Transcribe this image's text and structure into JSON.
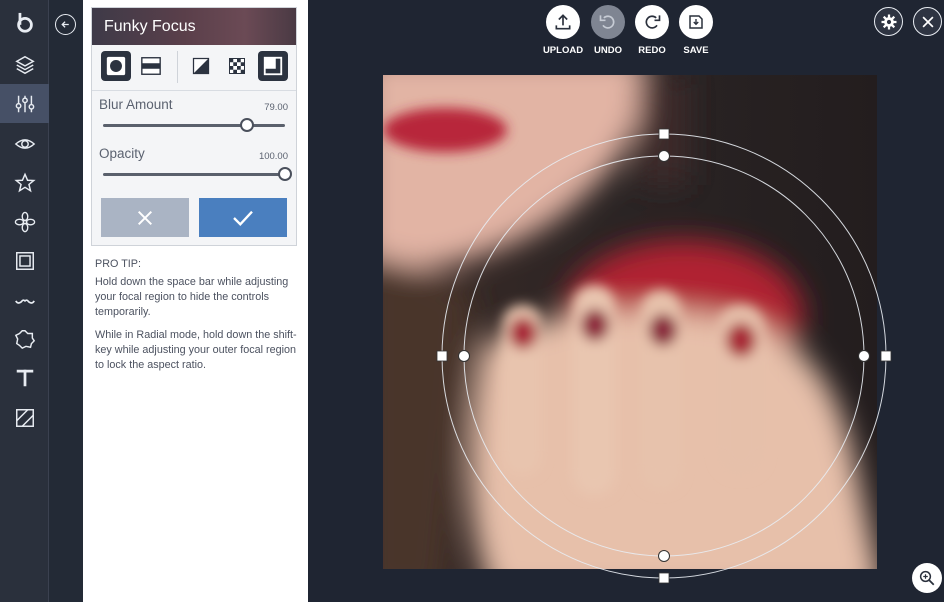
{
  "tool": {
    "title": "Funky Focus",
    "modes": [
      "radial-mode",
      "linear-mode",
      "invert-mode",
      "transparency-mode",
      "edge-mode"
    ],
    "blur": {
      "label": "Blur Amount",
      "value": "79.00",
      "fraction": 0.79
    },
    "opacity": {
      "label": "Opacity",
      "value": "100.00",
      "fraction": 1.0
    }
  },
  "tips": {
    "heading": "PRO TIP:",
    "p1": "Hold down the space bar while adjusting your focal region to hide the controls temporarily.",
    "p2": "While in Radial mode, hold down the shift-key while adjusting your outer focal region to lock the aspect ratio."
  },
  "toolbar": {
    "upload": "UPLOAD",
    "undo": "UNDO",
    "redo": "REDO",
    "save": "SAVE"
  },
  "rail": [
    "logo-icon",
    "layers-icon",
    "adjustments-icon",
    "eye-icon",
    "star-icon",
    "flower-icon",
    "frame-icon",
    "mustache-icon",
    "shape-icon",
    "text-icon",
    "texture-icon"
  ],
  "colors": {
    "background": "#1f2532",
    "rail": "#2a303c",
    "accent": "#4a7fbf",
    "cancel": "#aab4c4"
  }
}
